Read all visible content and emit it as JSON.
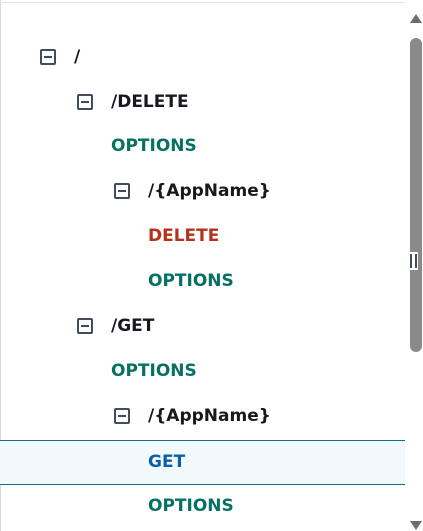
{
  "tree": {
    "rows": [
      {
        "label": "/",
        "kind": "resource",
        "expanded": true
      },
      {
        "label": "/DELETE",
        "kind": "resource",
        "expanded": true
      },
      {
        "label": "OPTIONS",
        "kind": "method-options"
      },
      {
        "label": "/{AppName}",
        "kind": "resource",
        "expanded": true
      },
      {
        "label": "DELETE",
        "kind": "method-delete"
      },
      {
        "label": "OPTIONS",
        "kind": "method-options"
      },
      {
        "label": "/GET",
        "kind": "resource",
        "expanded": true
      },
      {
        "label": "OPTIONS",
        "kind": "method-options"
      },
      {
        "label": "/{AppName}",
        "kind": "resource",
        "expanded": true
      },
      {
        "label": "GET",
        "kind": "method-get",
        "selected": true
      },
      {
        "label": "OPTIONS",
        "kind": "method-options"
      }
    ]
  },
  "colors": {
    "resource": "#16191f",
    "options": "#067062",
    "delete": "#b5321c",
    "get": "#0b5ea8",
    "selected_bg": "#f1f9fd",
    "selected_border": "#0f6f8a"
  },
  "icons": {
    "toggle": "collapse-square-icon",
    "resize": "resize-handle-icon"
  }
}
